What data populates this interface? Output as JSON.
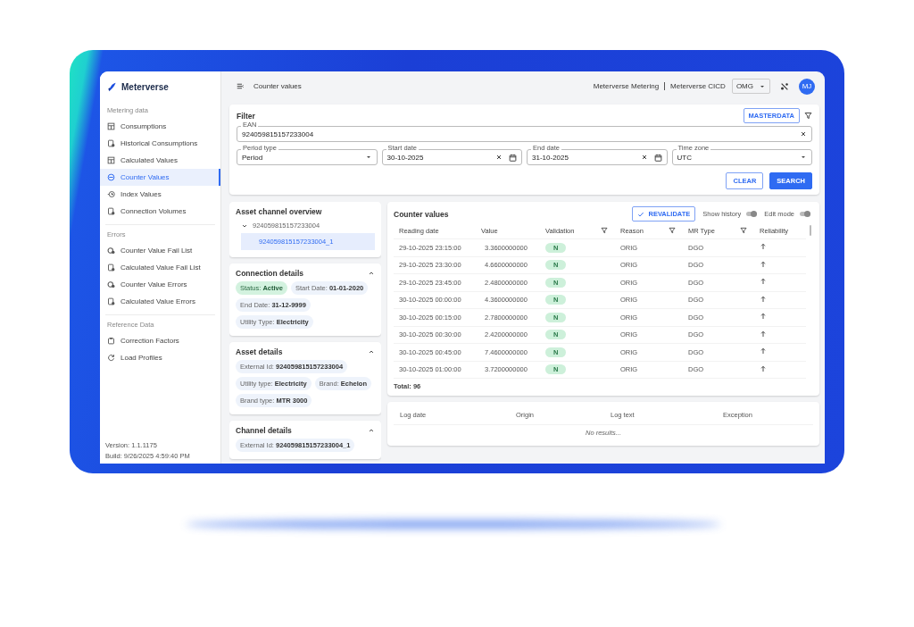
{
  "sidebar": {
    "logo": "Meterverse",
    "sections": [
      {
        "title": "Metering data",
        "items": [
          {
            "label": "Consumptions",
            "selected": false
          },
          {
            "label": "Historical Consumptions",
            "selected": false
          },
          {
            "label": "Calculated Values",
            "selected": false
          },
          {
            "label": "Counter Values",
            "selected": true
          },
          {
            "label": "Index Values",
            "selected": false
          },
          {
            "label": "Connection Volumes",
            "selected": false
          }
        ]
      },
      {
        "title": "Errors",
        "items": [
          {
            "label": "Counter Value Fail List",
            "selected": false
          },
          {
            "label": "Calculated Value Fail List",
            "selected": false
          },
          {
            "label": "Counter Value Errors",
            "selected": false
          },
          {
            "label": "Calculated Value Errors",
            "selected": false
          }
        ]
      },
      {
        "title": "Reference Data",
        "items": [
          {
            "label": "Correction Factors",
            "selected": false
          },
          {
            "label": "Load Profiles",
            "selected": false
          }
        ]
      }
    ],
    "version": "Version: 1.1.1175",
    "build": "Build: 9/26/2025 4:59:40 PM"
  },
  "topbar": {
    "title": "Counter values",
    "links": [
      "Meterverse Metering",
      "Meterverse CICD"
    ],
    "tenant": "OMG",
    "avatar": "MJ"
  },
  "filter": {
    "title": "Filter",
    "masterdata": "MASTERDATA",
    "ean": {
      "label": "EAN",
      "value": "924059815157233004"
    },
    "fields": [
      {
        "kind": "select",
        "label": "Period type",
        "value": "Period"
      },
      {
        "kind": "date",
        "label": "Start date",
        "value": "30-10-2025"
      },
      {
        "kind": "date",
        "label": "End date",
        "value": "31-10-2025"
      },
      {
        "kind": "select",
        "label": "Time zone",
        "value": "UTC"
      }
    ],
    "buttons": [
      {
        "label": "CLEAR",
        "kind": "outlined"
      },
      {
        "label": "SEARCH",
        "kind": "filled"
      }
    ]
  },
  "asset_overview": {
    "title": "Asset channel overview",
    "root": {
      "label": "924059815157233004",
      "expanded": true,
      "children": [
        {
          "label": "924059815157233004_1",
          "selected": true
        }
      ]
    }
  },
  "panels": [
    {
      "title": "Connection details",
      "expanded": true,
      "chips": [
        {
          "kind": "status",
          "label": "Status:",
          "value": "Active"
        },
        {
          "kind": "info",
          "label": "Start Date:",
          "value": "01-01-2020"
        },
        {
          "kind": "info",
          "label": "End Date:",
          "value": "31-12-9999"
        },
        {
          "kind": "info",
          "label": "Utility Type:",
          "value": "Electricity"
        }
      ]
    },
    {
      "title": "Asset details",
      "expanded": true,
      "chips": [
        {
          "kind": "info",
          "label": "External Id:",
          "value": "924059815157233004"
        },
        {
          "kind": "info",
          "label": "Utility type:",
          "value": "Electricity"
        },
        {
          "kind": "info",
          "label": "Brand:",
          "value": "Echelon"
        },
        {
          "kind": "info",
          "label": "Brand type:",
          "value": "MTR 3000"
        }
      ]
    },
    {
      "title": "Channel details",
      "expanded": true,
      "chips": [
        {
          "kind": "info",
          "label": "External Id:",
          "value": "924059815157233004_1"
        }
      ]
    }
  ],
  "counter_values": {
    "title": "Counter values",
    "revalidate": "REVALIDATE",
    "toggles": [
      {
        "label": "Show history",
        "on": false
      },
      {
        "label": "Edit mode",
        "on": false
      }
    ],
    "columns": [
      {
        "label": "Reading date",
        "filter": false
      },
      {
        "label": "Value",
        "filter": false
      },
      {
        "label": "Validation",
        "filter": true
      },
      {
        "label": "Reason",
        "filter": true
      },
      {
        "label": "MR Type",
        "filter": true
      },
      {
        "label": "Reliability",
        "filter": false
      }
    ],
    "rows": [
      {
        "reading_date": "29-10-2025 23:15:00",
        "value": "3.3600000000",
        "validation": "N",
        "reason": "ORIG",
        "mr_type": "DGO"
      },
      {
        "reading_date": "29-10-2025 23:30:00",
        "value": "4.6600000000",
        "validation": "N",
        "reason": "ORIG",
        "mr_type": "DGO"
      },
      {
        "reading_date": "29-10-2025 23:45:00",
        "value": "2.4800000000",
        "validation": "N",
        "reason": "ORIG",
        "mr_type": "DGO"
      },
      {
        "reading_date": "30-10-2025 00:00:00",
        "value": "4.3600000000",
        "validation": "N",
        "reason": "ORIG",
        "mr_type": "DGO"
      },
      {
        "reading_date": "30-10-2025 00:15:00",
        "value": "2.7800000000",
        "validation": "N",
        "reason": "ORIG",
        "mr_type": "DGO"
      },
      {
        "reading_date": "30-10-2025 00:30:00",
        "value": "2.4200000000",
        "validation": "N",
        "reason": "ORIG",
        "mr_type": "DGO"
      },
      {
        "reading_date": "30-10-2025 00:45:00",
        "value": "7.4600000000",
        "validation": "N",
        "reason": "ORIG",
        "mr_type": "DGO"
      },
      {
        "reading_date": "30-10-2025 01:00:00",
        "value": "3.7200000000",
        "validation": "N",
        "reason": "ORIG",
        "mr_type": "DGO"
      }
    ],
    "total": "Total: 96"
  },
  "log": {
    "columns": [
      "Log date",
      "Origin",
      "Log text",
      "Exception"
    ],
    "empty": "No results..."
  }
}
